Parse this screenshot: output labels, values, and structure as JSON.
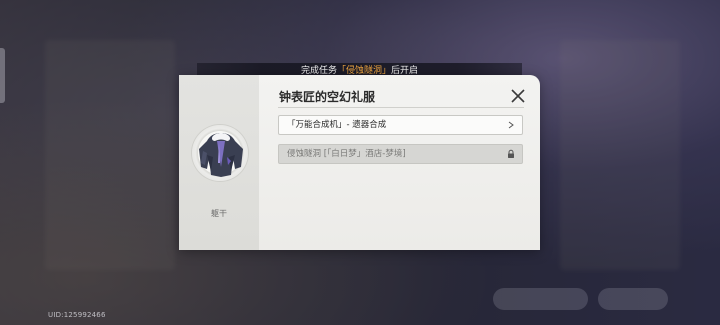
{
  "background": {
    "uid": "UID:125992466"
  },
  "notice": {
    "prefix": "完成任务",
    "quest": "「侵蚀隧洞」",
    "suffix": "后开启",
    "highlight_color": "#f0a640"
  },
  "dialog": {
    "title": "钟表匠的空幻礼服",
    "item_name": "躯干",
    "item_icon": "clothing-relic-icon",
    "sources": [
      {
        "label": "「万能合成机」- 遗器合成",
        "state": "available",
        "icon": "chevron-right-icon"
      },
      {
        "label": "侵蚀隧洞 [「白日梦」酒店-梦境]",
        "state": "locked",
        "icon": "lock-icon"
      }
    ],
    "close_icon": "close-icon"
  }
}
